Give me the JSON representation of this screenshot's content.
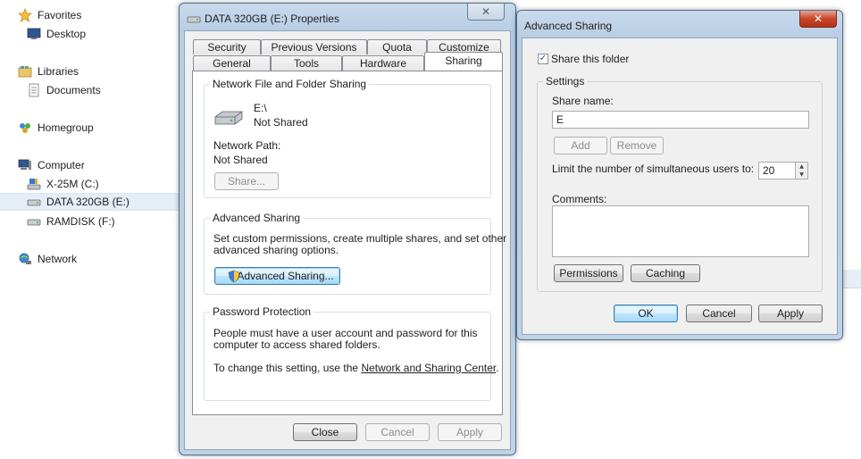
{
  "nav": {
    "favorites": "Favorites",
    "desktop": "Desktop",
    "libraries": "Libraries",
    "documents": "Documents",
    "homegroup": "Homegroup",
    "computer": "Computer",
    "drive_c": "X-25M (C:)",
    "drive_e": "DATA 320GB (E:)",
    "drive_f": "RAMDISK (F:)",
    "network": "Network"
  },
  "props": {
    "title": "DATA 320GB (E:) Properties",
    "close_glyph": "✕",
    "tabs_row1": [
      "Security",
      "Previous Versions",
      "Quota",
      "Customize"
    ],
    "tabs_row2": [
      "General",
      "Tools",
      "Hardware",
      "Sharing"
    ],
    "active_tab": "Sharing",
    "nffs": {
      "label": "Network File and Folder Sharing",
      "path": "E:\\",
      "status": "Not Shared",
      "network_path_label": "Network Path:",
      "network_path_value": "Not Shared",
      "share_button": "Share..."
    },
    "adv": {
      "label": "Advanced Sharing",
      "desc_line1": "Set custom permissions, create multiple shares, and set other",
      "desc_line2": "advanced sharing options.",
      "button": "Advanced Sharing..."
    },
    "pwd": {
      "label": "Password Protection",
      "line1": "People must have a user account and password for this",
      "line2": "computer to access shared folders.",
      "line3_prefix": "To change this setting, use the ",
      "line3_link": "Network and Sharing Center",
      "line3_suffix": "."
    },
    "buttons": {
      "close": "Close",
      "cancel": "Cancel",
      "apply": "Apply"
    }
  },
  "adv_dialog": {
    "title": "Advanced Sharing",
    "close_glyph": "✕",
    "share_folder_label": "Share this folder",
    "share_folder_checked": true,
    "check_glyph": "✓",
    "settings_label": "Settings",
    "share_name_label": "Share name:",
    "share_name_value": "E",
    "add_button": "Add",
    "remove_button": "Remove",
    "limit_label": "Limit the number of simultaneous users to:",
    "limit_value": "20",
    "comments_label": "Comments:",
    "comments_value": "",
    "permissions_button": "Permissions",
    "caching_button": "Caching",
    "ok_button": "OK",
    "cancel_button": "Cancel",
    "apply_button": "Apply"
  },
  "colors": {
    "accent": "#3c7fb1",
    "selection": "#e5eef7",
    "close_active": "#c7462b"
  }
}
